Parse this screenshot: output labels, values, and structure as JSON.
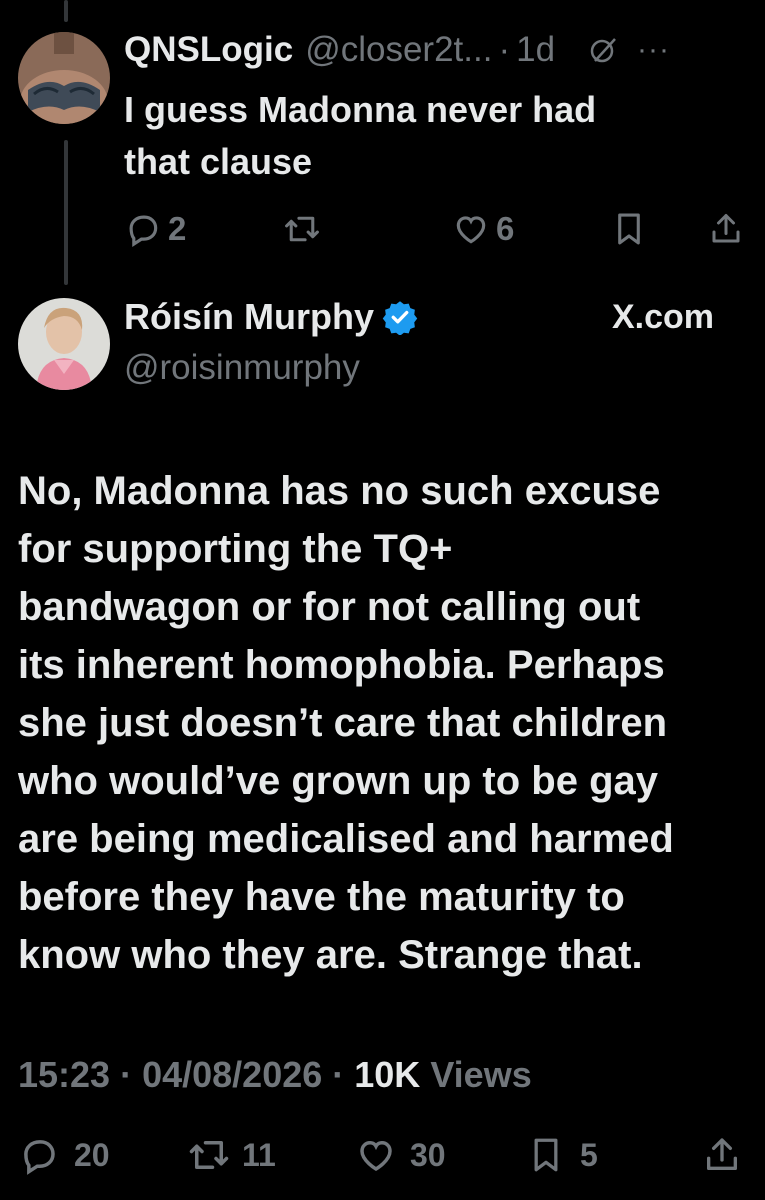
{
  "reply": {
    "display_name": "QNSLogic",
    "handle": "@closer2t...",
    "dot": "·",
    "time": "1d",
    "more": "···",
    "text_lines": [
      "I guess Madonna never had",
      "that clause"
    ],
    "actions": {
      "replies": "2",
      "reposts": "",
      "likes": "6"
    }
  },
  "tweet": {
    "display_name": "Róisín Murphy",
    "verified": true,
    "handle": "@roisinmurphy",
    "source": "X.com",
    "text_lines": [
      "No, Madonna has no such excuse",
      "for supporting the TQ+",
      "bandwagon or for not calling out",
      "its inherent homophobia. Perhaps",
      "she just doesn’t care that children",
      "who would’ve grown up to be gay",
      "are being medicalised and harmed",
      "before they have the maturity to",
      "know who they are. Strange that."
    ],
    "meta": {
      "time": "15:23",
      "sep1": " · ",
      "date": "04/08/2026",
      "sep2": " · ",
      "views_count": "10K",
      "views_label": " Views"
    },
    "stats": {
      "replies": "20",
      "reposts": "11",
      "likes": "30",
      "bookmarks": "5"
    }
  },
  "colors": {
    "background": "#000000",
    "text": "#e7e9ea",
    "muted": "#71767b",
    "verified": "#1d9bf0",
    "accent": "#1d9bf0"
  },
  "icons": [
    "reply-icon",
    "repost-icon",
    "like-icon",
    "bookmark-icon",
    "share-icon",
    "grok-icon",
    "more-icon",
    "verified-badge-icon",
    "x-logo-icon"
  ]
}
